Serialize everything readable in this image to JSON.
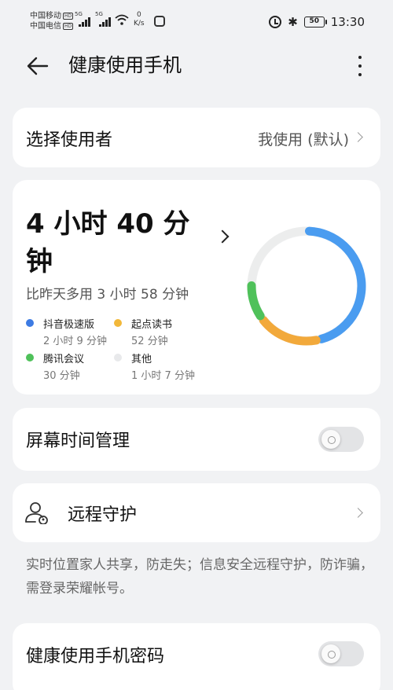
{
  "status_bar": {
    "carrier_1": "中国移动",
    "carrier_2": "中国电信",
    "hd_badge": "HD",
    "network_1": "5G",
    "network_2": "5G",
    "net_speed_value": "0",
    "net_speed_unit": "K/s",
    "battery": "50",
    "time": "13:30",
    "icons": [
      "signal-icon",
      "wifi-icon",
      "shield-icon",
      "alarm-icon",
      "bluetooth-icon",
      "battery-icon"
    ]
  },
  "header": {
    "title": "健康使用手机",
    "back_icon": "arrow-left-icon",
    "more_icon": "more-vertical-icon"
  },
  "user_selector": {
    "label": "选择使用者",
    "value": "我使用 (默认)"
  },
  "usage": {
    "total_time": "4 小时 40 分钟",
    "comparison": "比昨天多用 3 小时 58 分钟",
    "apps": [
      {
        "name": "抖音极速版",
        "duration": "2 小时 9 分钟",
        "color": "#3d7be3",
        "minutes": 129
      },
      {
        "name": "起点读书",
        "duration": "52 分钟",
        "color": "#f2b83a",
        "minutes": 52
      },
      {
        "name": "腾讯会议",
        "duration": "30 分钟",
        "color": "#4fc15a",
        "minutes": 30
      },
      {
        "name": "其他",
        "duration": "1 小时 7 分钟",
        "color": "#e8e9eb",
        "minutes": 67
      }
    ]
  },
  "screen_time": {
    "label": "屏幕时间管理",
    "enabled": false
  },
  "remote_guard": {
    "label": "远程守护",
    "description": "实时位置家人共享，防走失；信息安全远程守护，防诈骗，需登录荣耀帐号。",
    "icon": "people-icon"
  },
  "password": {
    "label": "健康使用手机密码",
    "enabled": false
  },
  "colors": {
    "background": "#f1f2f4",
    "card": "#ffffff",
    "ring_blue": "#4a9cf0",
    "ring_orange": "#f2a93b",
    "ring_green": "#4fc15a"
  }
}
